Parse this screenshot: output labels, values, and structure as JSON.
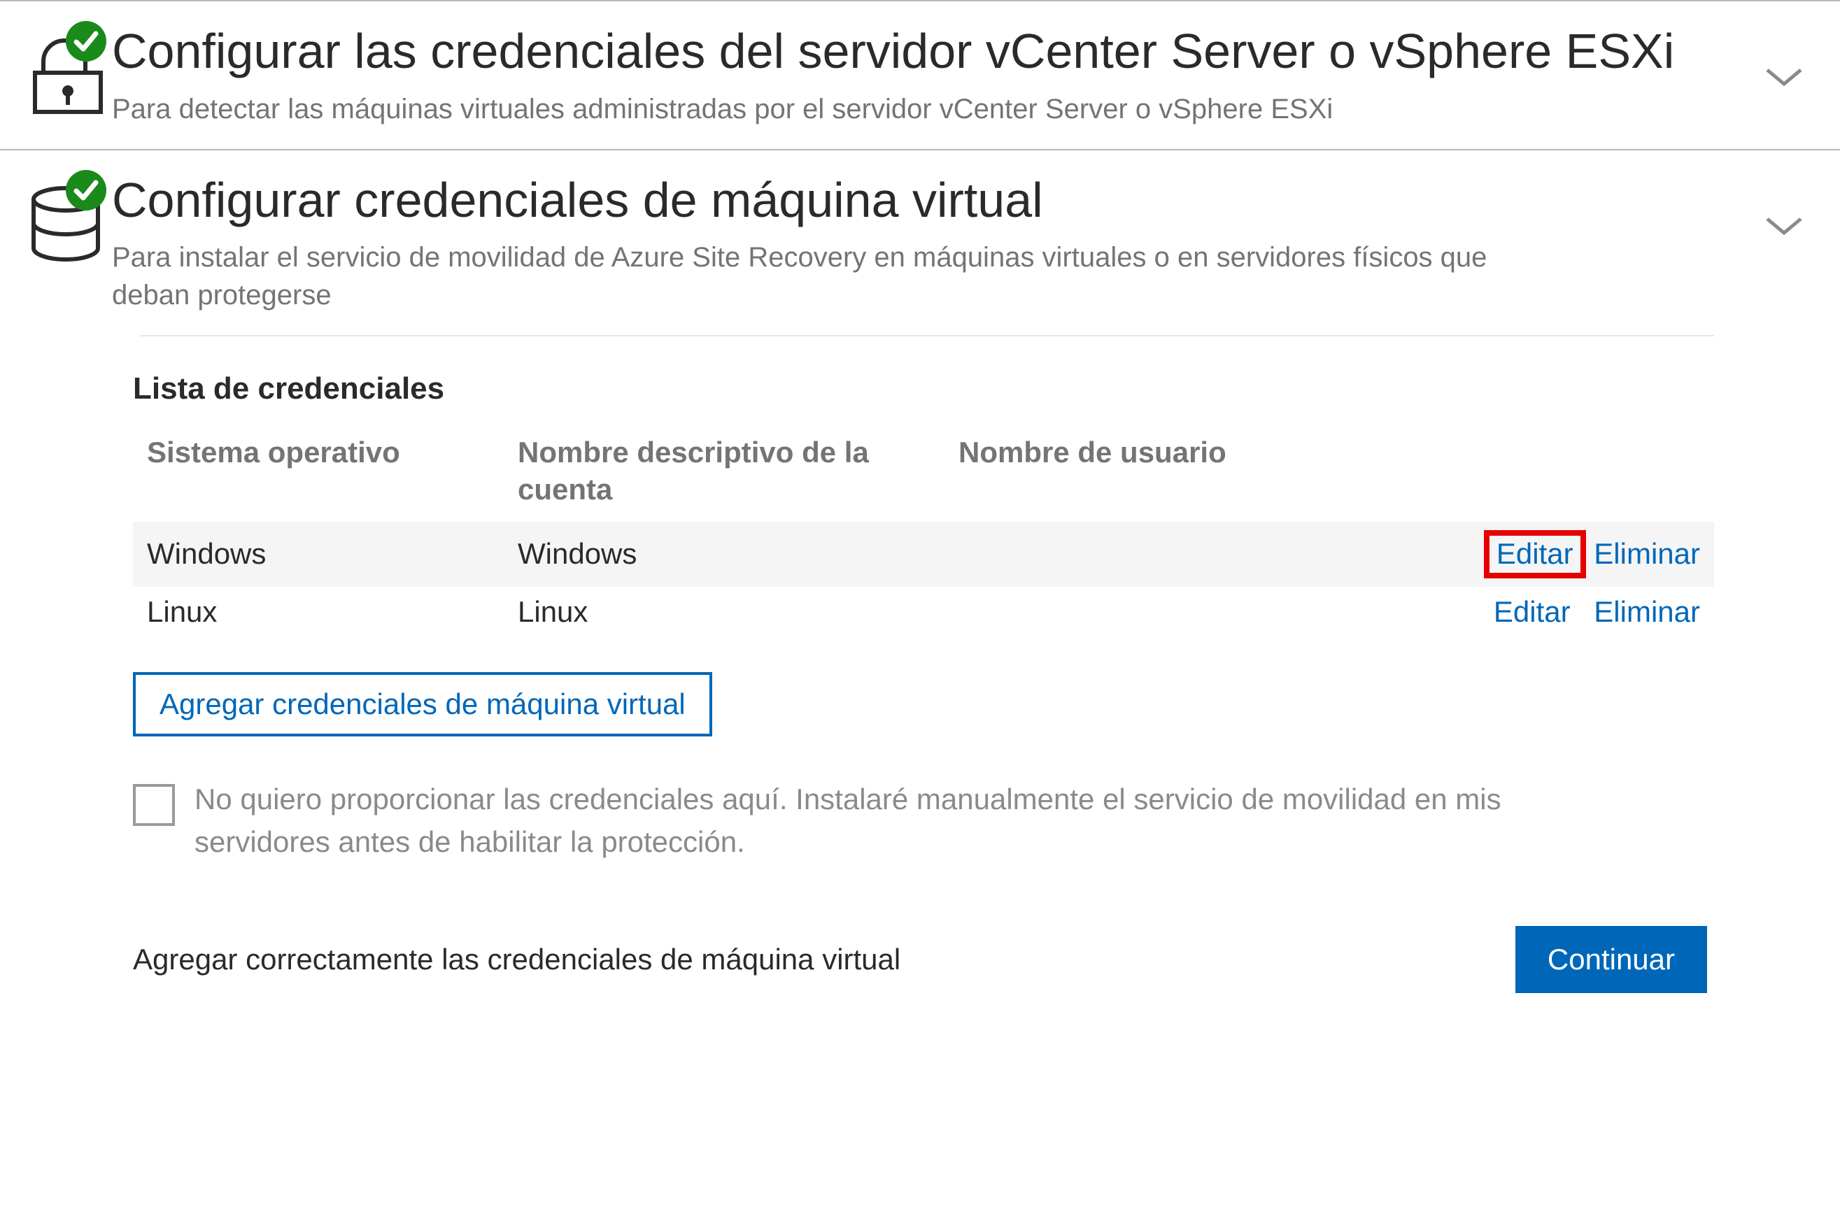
{
  "section_vcenter": {
    "title": "Configurar las credenciales del servidor vCenter Server o vSphere ESXi",
    "subtitle": "Para detectar las máquinas virtuales administradas por el servidor vCenter Server o vSphere ESXi"
  },
  "section_vm": {
    "title": "Configurar credenciales de máquina virtual",
    "subtitle": "Para instalar el servicio de movilidad de Azure Site Recovery en máquinas virtuales o en servidores físicos que deban protegerse"
  },
  "credentials": {
    "heading": "Lista de credenciales",
    "columns": {
      "os": "Sistema operativo",
      "account": "Nombre descriptivo de la cuenta",
      "user": "Nombre de usuario"
    },
    "rows": [
      {
        "os": "Windows",
        "account": "Windows",
        "user": "",
        "edit": "Editar",
        "delete": "Eliminar"
      },
      {
        "os": "Linux",
        "account": "Linux",
        "user": "",
        "edit": "Editar",
        "delete": "Eliminar"
      }
    ],
    "add_button": "Agregar credenciales de máquina virtual",
    "skip_checkbox": "No quiero proporcionar las credenciales aquí. Instalaré manualmente el servicio de movilidad en mis servidores antes de habilitar la protección."
  },
  "footer": {
    "status": "Agregar correctamente las credenciales de máquina virtual",
    "continue": "Continuar"
  },
  "colors": {
    "link": "#0067b8",
    "primary": "#0067b8",
    "success": "#1a8a1a",
    "highlight": "#e60000"
  }
}
